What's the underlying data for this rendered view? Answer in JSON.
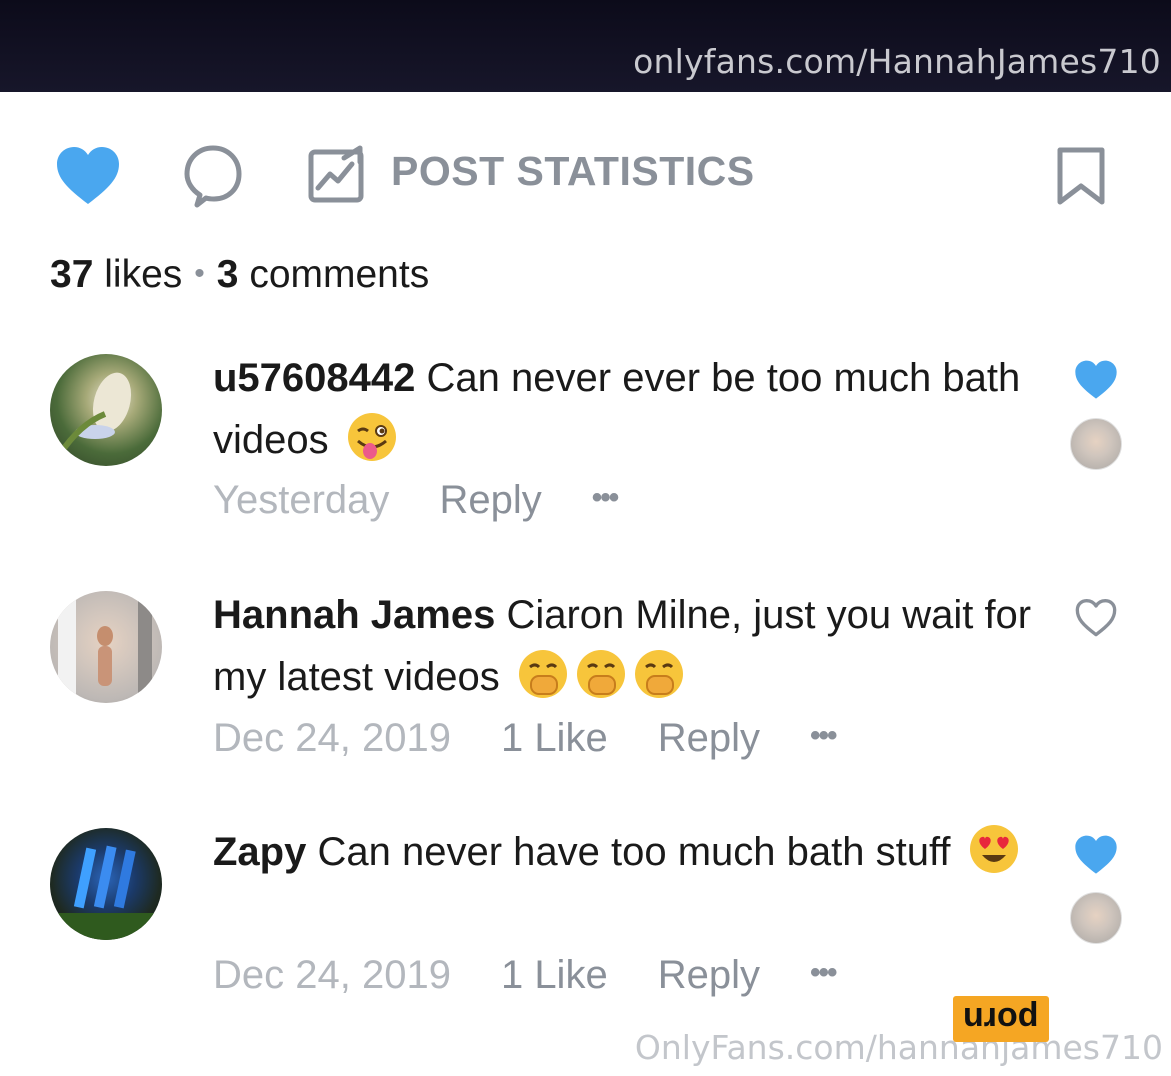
{
  "header": {
    "url": "onlyfans.com/HannahJames710"
  },
  "actions": {
    "post_statistics_label": "POST STATISTICS",
    "like_color": "#4aa7ef",
    "icon_gray": "#8a9099"
  },
  "summary": {
    "likes_count": "37",
    "likes_word": "likes",
    "separator": "•",
    "comments_count": "3",
    "comments_word": "comments"
  },
  "comments": [
    {
      "username": "u57608442",
      "text": "Can never ever be too much bath videos",
      "emoji": "winking-face-with-tongue",
      "date": "Yesterday",
      "likes": "",
      "reply_label": "Reply",
      "more_label": "•••",
      "liked": true
    },
    {
      "username": "Hannah James",
      "text": "Ciaron Milne, just you wait for my latest videos",
      "emoji": "face-with-hand-over-mouth x3",
      "date": "Dec 24, 2019",
      "likes": "1 Like",
      "reply_label": "Reply",
      "more_label": "•••",
      "liked": false
    },
    {
      "username": "Zapy",
      "text": "Can never have too much bath stuff",
      "emoji": "smiling-face-with-heart-eyes",
      "date": "Dec 24, 2019",
      "likes": "1 Like",
      "reply_label": "Reply",
      "more_label": "•••",
      "liked": true
    }
  ],
  "footer": {
    "watermark": "OnlyFans.com/hannahjames710",
    "badge": "porn"
  }
}
